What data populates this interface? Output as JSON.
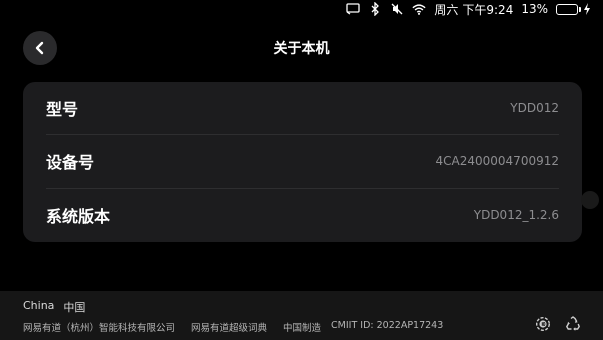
{
  "status_bar": {
    "day": "周六",
    "time": "下午9:24",
    "battery": "13%",
    "battery_level": 0.13,
    "icons": [
      "screen-cast-icon",
      "bluetooth-icon",
      "mute-icon",
      "wifi-icon",
      "battery-icon",
      "charging-icon"
    ]
  },
  "header": {
    "title": "关于本机",
    "back_icon": "chevron-left-icon"
  },
  "info_rows": [
    {
      "label": "型号",
      "value": "YDD012"
    },
    {
      "label": "设备号",
      "value": "4CA2400004700912"
    },
    {
      "label": "系统版本",
      "value": "YDD012_1.2.6"
    }
  ],
  "footer": {
    "country_en": "China",
    "country_zh": "中国",
    "company": "网易有道（杭州）智能科技有限公司",
    "product": "网易有道超级词典",
    "made_in": "中国制造",
    "cmiit": "CMIIT ID: 2022AP17243",
    "icons": [
      "recycling-10-icon",
      "recycle-icon"
    ]
  },
  "colors": {
    "background": "#000000",
    "card": "#1c1c1e",
    "footer": "#161616",
    "value_text": "#8d8d90"
  }
}
